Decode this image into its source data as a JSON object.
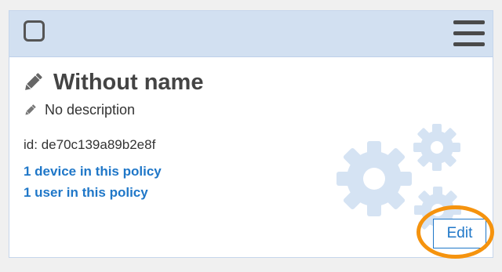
{
  "card": {
    "name": "Without name",
    "description": "No description",
    "id_label": "id:",
    "id_value": "de70c139a89b2e8f",
    "devices_link": "1 device in this policy",
    "users_link": "1 user in this policy",
    "edit_label": "Edit"
  },
  "icons": {
    "checkbox": "checkbox-icon",
    "menu": "hamburger-menu-icon",
    "title_edit": "pencil-icon",
    "description_edit": "pencil-icon",
    "background": "gears-icon"
  },
  "colors": {
    "header": "#d2e0f1",
    "link": "#1f77c8",
    "highlight": "#f5930e",
    "gears": "#d5e3f3"
  }
}
